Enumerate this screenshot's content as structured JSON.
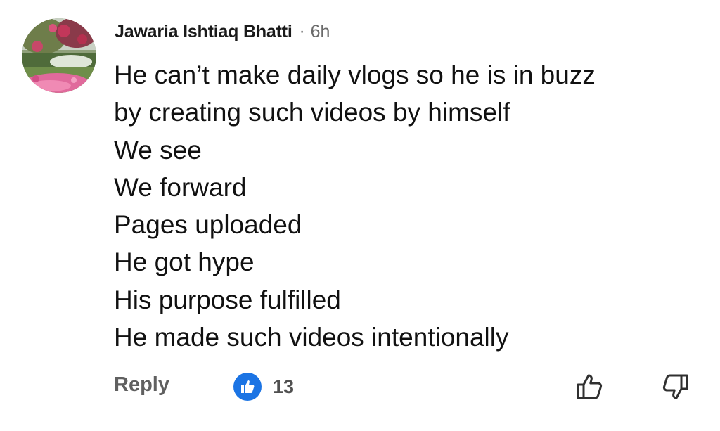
{
  "comment": {
    "author": "Jawaria Ishtiaq Bhatti",
    "separator": "·",
    "time": "6h",
    "lines": [
      "He can’t make daily vlogs so he is in buzz",
      "by creating such videos by himself",
      "We see",
      "We forward",
      "Pages uploaded",
      "He got hype",
      "His purpose fulfilled",
      "He made such videos intentionally"
    ]
  },
  "actions": {
    "reply_label": "Reply",
    "reaction_count": "13",
    "reaction_icon": "like-icon",
    "reaction_color": "#1b74e4",
    "vote_up_icon": "thumbs-up-outline-icon",
    "vote_down_icon": "thumbs-down-outline-icon"
  }
}
